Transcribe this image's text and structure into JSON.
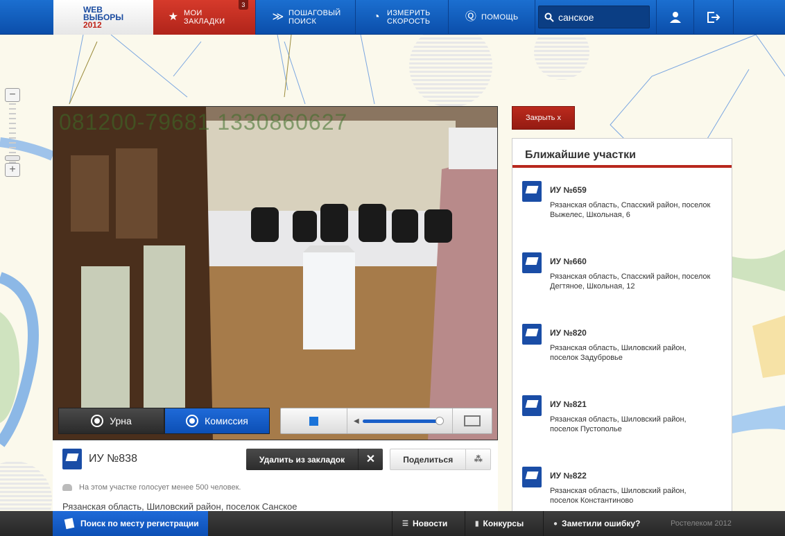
{
  "header": {
    "logo_line1": "WEB",
    "logo_line2": "ВЫБОРЫ",
    "logo_line3": "2012",
    "bookmarks_label_1": "МОИ",
    "bookmarks_label_2": "ЗАКЛАДКИ",
    "bookmarks_count": "3",
    "step_search_1": "ПОШАГОВЫЙ",
    "step_search_2": "ПОИСК",
    "speed_1": "ИЗМЕРИТЬ",
    "speed_2": "СКОРОСТЬ",
    "help_label": "ПОМОЩЬ",
    "search_value": "санское"
  },
  "video": {
    "timestamp": "081200-79681 1330860627",
    "tab_urn": "Урна",
    "tab_commission": "Комиссия"
  },
  "poll": {
    "title": "ИУ №838",
    "remove_bookmark": "Удалить из закладок",
    "share": "Поделиться",
    "voters_note": "На этом участке голосует менее 500 человек.",
    "address": "Рязанская область, Шиловский район, поселок Санское"
  },
  "panel": {
    "close_label": "Закрыть  x",
    "title": "Ближайшие участки",
    "stations": [
      {
        "name": "ИУ №659",
        "addr": "Рязанская область, Спасский район, поселок Выжелес, Школьная, 6"
      },
      {
        "name": "ИУ №660",
        "addr": "Рязанская область, Спасский район, поселок Дегтяное, Школьная, 12"
      },
      {
        "name": "ИУ №820",
        "addr": "Рязанская область, Шиловский район, поселок Задубровье"
      },
      {
        "name": "ИУ №821",
        "addr": "Рязанская область, Шиловский район, поселок Пустополье"
      },
      {
        "name": "ИУ №822",
        "addr": "Рязанская область, Шиловский район, поселок Константиново"
      }
    ]
  },
  "footer": {
    "reg_search": "Поиск по месту регистрации",
    "news": "Новости",
    "contests": "Конкурсы",
    "report_error": "Заметили ошибку?",
    "copyright": "Ростелеком 2012"
  },
  "colors": {
    "brand_blue": "#0b4eaa",
    "accent_red": "#b8281d",
    "map_bg": "#fbf9ec"
  }
}
